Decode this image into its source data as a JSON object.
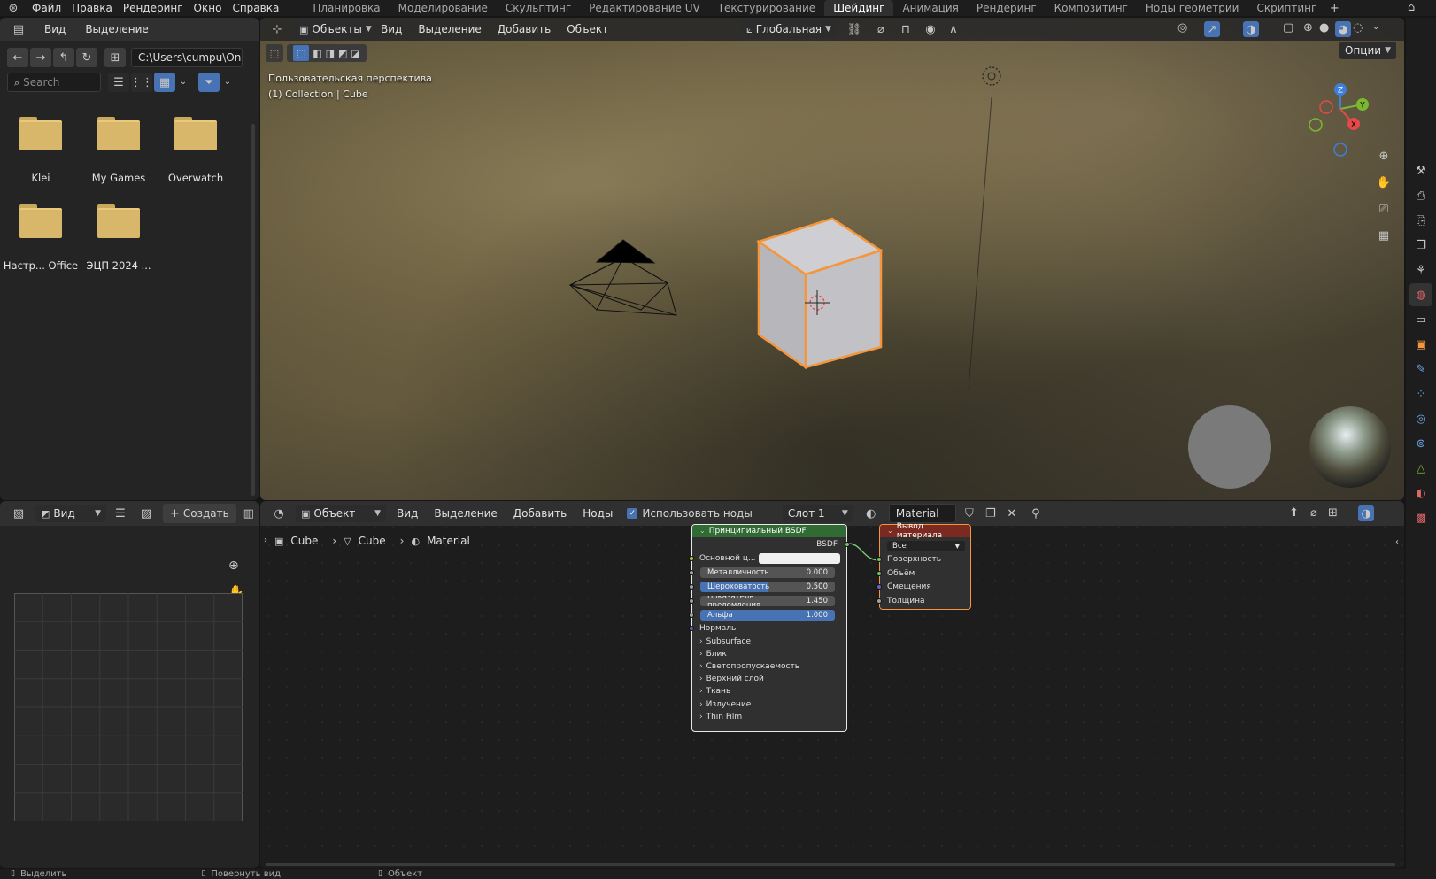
{
  "topbar": {
    "menus": [
      "Файл",
      "Правка",
      "Рендеринг",
      "Окно",
      "Справка"
    ],
    "workspaces": [
      "Планировка",
      "Моделирование",
      "Скульптинг",
      "Редактирование UV",
      "Текстурирование",
      "Шейдинг",
      "Анимация",
      "Рендеринг",
      "Композитинг",
      "Ноды геометрии",
      "Скриптинг"
    ],
    "active_workspace": "Шейдинг"
  },
  "file_browser": {
    "menus": [
      "Вид",
      "Выделение"
    ],
    "path": "C:\\Users\\cumpu\\On...",
    "search_placeholder": "Search",
    "folders": [
      "Klei",
      "My Games",
      "Overwatch",
      "Настр... Office",
      "ЭЦП 2024 ..."
    ]
  },
  "viewport": {
    "mode": "Объекты",
    "menus": [
      "Вид",
      "Выделение",
      "Добавить",
      "Объект"
    ],
    "orientation": "Глобальная",
    "options_label": "Опции",
    "overlay_line1": "Пользовательская перспектива",
    "overlay_line2": "(1) Collection | Cube",
    "gizmo_axes": {
      "z": "Z",
      "y": "Y",
      "x": "X"
    }
  },
  "image_editor": {
    "view_label": "Вид",
    "new_label": "Создать"
  },
  "node_editor": {
    "mode": "Объект",
    "menus": [
      "Вид",
      "Выделение",
      "Добавить",
      "Ноды"
    ],
    "use_nodes_label": "Использовать ноды",
    "slot": "Слот 1",
    "material": "Material",
    "breadcrumb": [
      "Cube",
      "Cube",
      "Material"
    ],
    "bsdf_node": {
      "title": "Принципиальный BSDF",
      "output": "BSDF",
      "base_color_label": "Основной ц...",
      "metallic_label": "Металличность",
      "metallic_value": "0.000",
      "roughness_label": "Шероховатость",
      "roughness_value": "0.500",
      "ior_label": "Показатель преломления",
      "ior_value": "1.450",
      "alpha_label": "Альфа",
      "alpha_value": "1.000",
      "normal_label": "Нормаль",
      "panels": [
        "Subsurface",
        "Блик",
        "Светопропускаемость",
        "Верхний слой",
        "Ткань",
        "Излучение",
        "Thin Film"
      ]
    },
    "output_node": {
      "title": "Вывод материала",
      "target": "Все",
      "inputs": [
        "Поверхность",
        "Объём",
        "Смещения",
        "Толщина"
      ]
    }
  },
  "status_bar": {
    "items": [
      "Выделить",
      "Повернуть вид",
      "Объект"
    ]
  },
  "colors": {
    "accent": "#4772b3",
    "selection_orange": "#f5963c",
    "bsdf_header": "#2f6b33",
    "output_header": "#7a2a20"
  }
}
